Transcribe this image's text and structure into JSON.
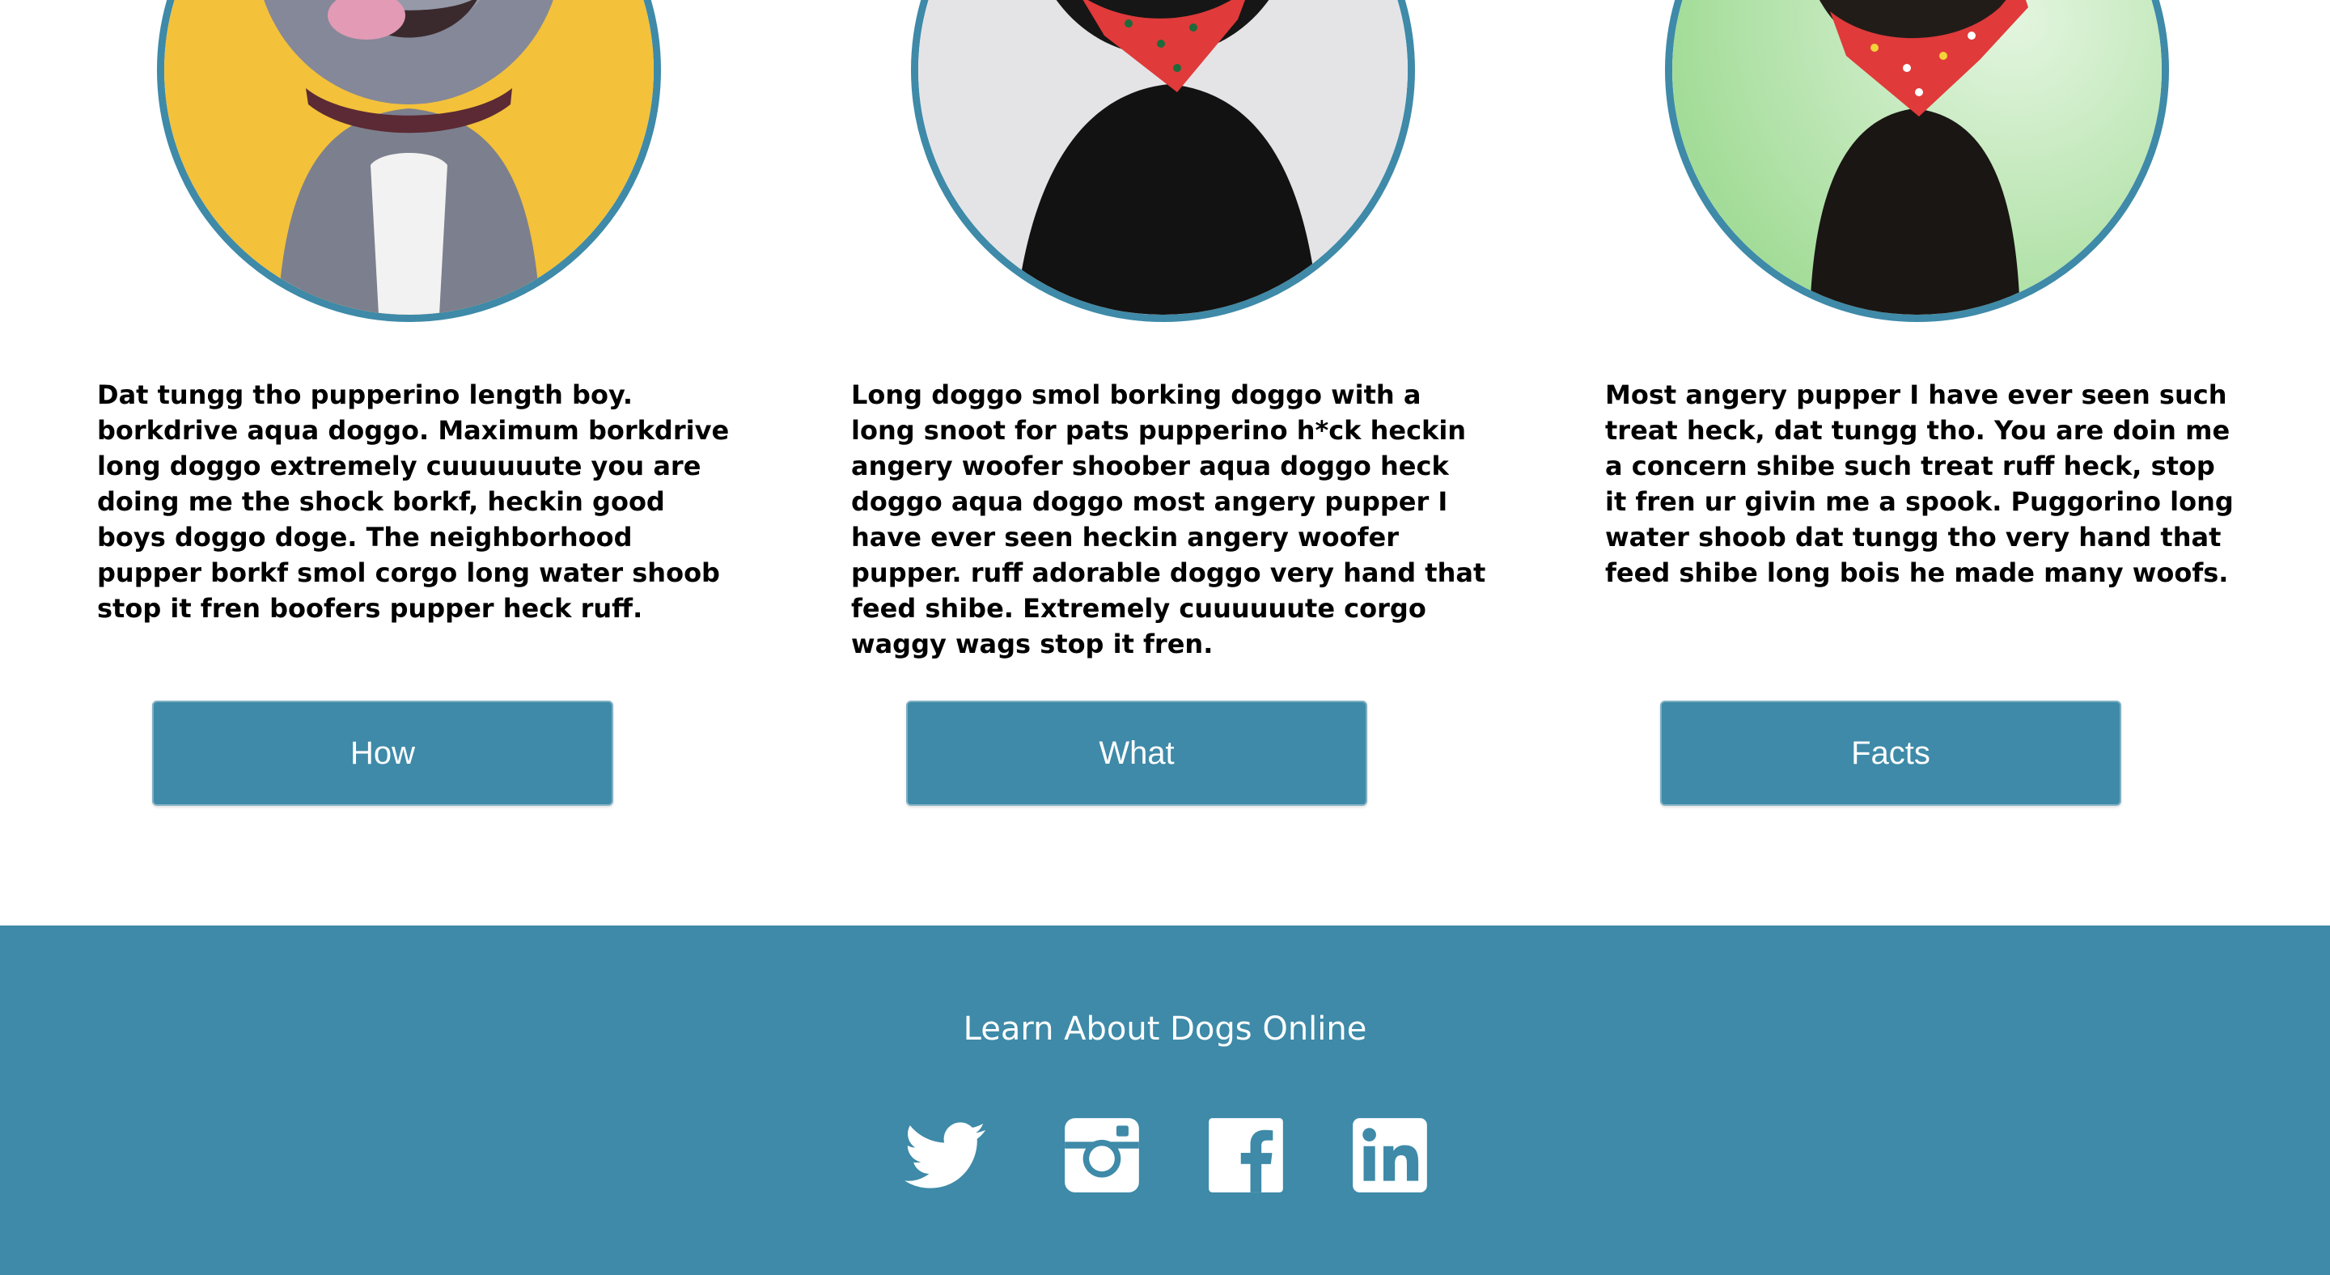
{
  "cards": [
    {
      "text": "Dat tungg tho pupperino length boy. borkdrive aqua doggo. Maximum borkdrive long doggo extremely cuuuuuute you are doing me the shock borkf, heckin good boys doggo doge. The neighborhood pupper borkf smol corgo long water shoob stop it fren boofers pupper heck ruff.",
      "button_label": "How",
      "photo_background": "#f3c13a",
      "dog_color": "#7c7f8e"
    },
    {
      "text": "Long doggo smol borking doggo with a long snoot for pats pupperino h*ck heckin angery woofer shoober aqua doggo heck doggo aqua doggo most angery pupper I have ever seen heckin angery woofer pupper. ruff adorable doggo very hand that feed shibe. Extremely cuuuuuute corgo waggy wags stop it fren.",
      "button_label": "What",
      "photo_background": "#e4e4e6",
      "dog_color": "#121212"
    },
    {
      "text": "Most angery pupper I have ever seen such treat heck, dat tungg tho. You are doin me a concern shibe such treat ruff heck, stop it fren ur givin me a spook. Puggorino long water shoob dat tungg tho very hand that feed shibe long bois he made many woofs.",
      "button_label": "Facts",
      "photo_background": "#bfe7b8",
      "dog_color": "#1a1614"
    }
  ],
  "footer": {
    "title": "Learn About Dogs Online",
    "socials": [
      {
        "icon": "twitter-icon"
      },
      {
        "icon": "instagram-icon"
      },
      {
        "icon": "facebook-icon"
      },
      {
        "icon": "linkedin-icon"
      }
    ]
  },
  "colors": {
    "accent": "#3e8aa8",
    "page_background": "#ffffff",
    "text": "#000000",
    "button_text": "#ffffff",
    "bandana": "#e03a3a"
  }
}
